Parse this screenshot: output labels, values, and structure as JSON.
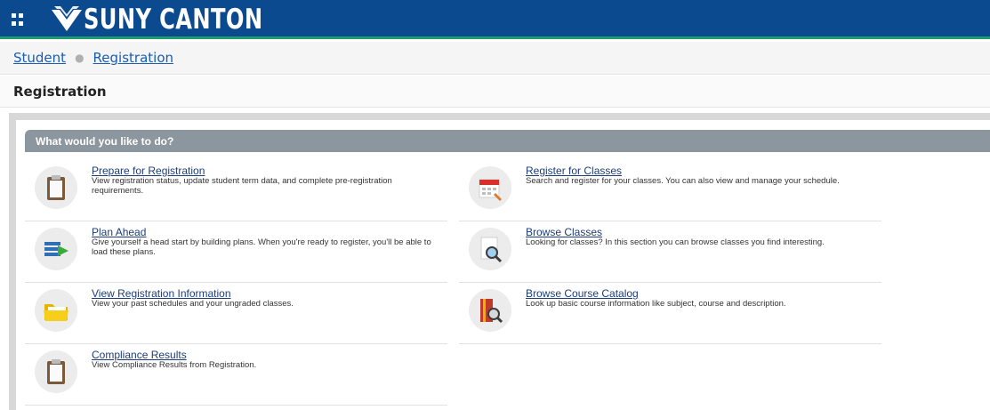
{
  "header": {
    "logo_text": "SUNY CANTON",
    "colors": {
      "bar": "#0c4a8f",
      "accent_line": "#1f9c6e"
    }
  },
  "breadcrumb": {
    "items": [
      {
        "label": "Student"
      },
      {
        "label": "Registration"
      }
    ]
  },
  "page": {
    "title": "Registration"
  },
  "section": {
    "heading": "What would you like to do?"
  },
  "left_items": [
    {
      "title": "Prepare for Registration",
      "description": "View registration status, update student term data, and complete pre-registration requirements.",
      "icon": "clipboard-icon"
    },
    {
      "title": "Plan Ahead",
      "description": "Give yourself a head start by building plans. When you're ready to register, you'll be able to load these plans.",
      "icon": "plan-list-icon"
    },
    {
      "title": "View Registration Information",
      "description": "View your past schedules and your ungraded classes.",
      "icon": "folder-icon"
    },
    {
      "title": "Compliance Results",
      "description": "View Compliance Results from Registration.",
      "icon": "clipboard-icon"
    }
  ],
  "right_items": [
    {
      "title": "Register for Classes",
      "description": "Search and register for your classes. You can also view and manage your schedule.",
      "icon": "calendar-pencil-icon"
    },
    {
      "title": "Browse Classes",
      "description": "Looking for classes? In this section you can browse classes you find interesting.",
      "icon": "document-search-icon"
    },
    {
      "title": "Browse Course Catalog",
      "description": "Look up basic course information like subject, course and description.",
      "icon": "book-search-icon"
    }
  ]
}
